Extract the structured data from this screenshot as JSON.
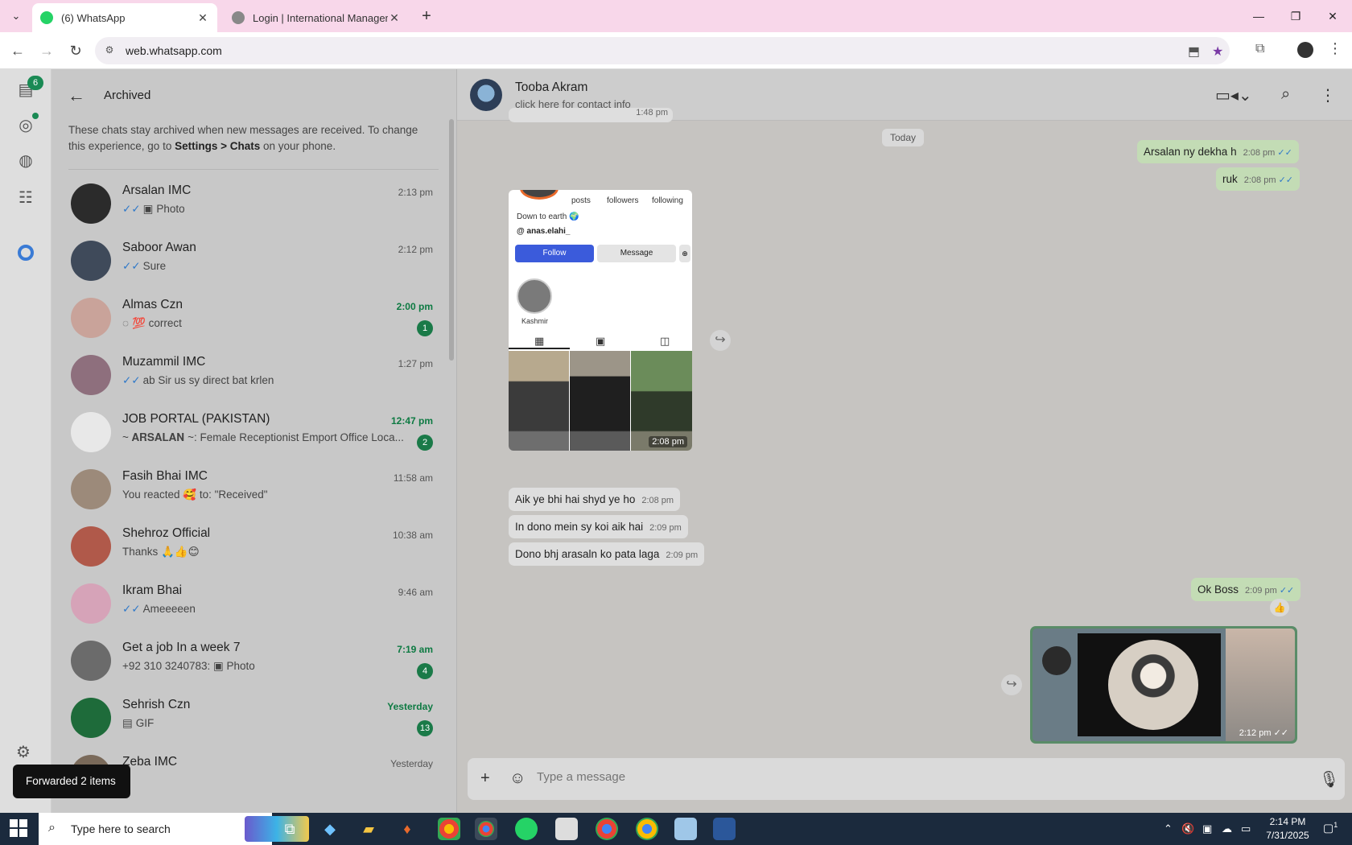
{
  "browser": {
    "tabs": [
      {
        "label": "(6) WhatsApp",
        "active": true
      },
      {
        "label": "Login | International Manageme",
        "active": false
      }
    ],
    "url": "web.whatsapp.com"
  },
  "rail": {
    "chats_badge": "6"
  },
  "panel": {
    "title": "Archived",
    "note_part1": "These chats stay archived when new messages are received. To change this experience, go to ",
    "note_bold1": "Settings > Chats",
    "note_part2": " on your phone.",
    "chats": [
      {
        "name": "Arsalan IMC",
        "time": "2:13 pm",
        "preview": "Photo",
        "ticks": "✓✓",
        "media": "▣",
        "unread": "",
        "avatar_color": "#2b2b2b"
      },
      {
        "name": "Saboor Awan",
        "time": "2:12 pm",
        "preview": "Sure",
        "ticks": "✓✓",
        "media": "",
        "unread": "",
        "avatar_color": "#3f4a5a"
      },
      {
        "name": "Almas Czn",
        "time": "2:00 pm",
        "preview": "💯 correct",
        "ticks": "",
        "media": "◌",
        "unread": "1",
        "avatar_color": "#c9a39a"
      },
      {
        "name": "Muzammil IMC",
        "time": "1:27 pm",
        "preview": "ab Sir us sy direct bat krlen",
        "ticks": "✓✓",
        "media": "",
        "unread": "",
        "avatar_color": "#8e6f7d"
      },
      {
        "name": "JOB PORTAL (PAKISTAN)",
        "time": "12:47 pm",
        "preview": "~ 𝐀𝐑𝐒𝐀𝐋𝐀𝐍 ~: Female Receptionist Emport Office  Loca...",
        "ticks": "",
        "media": "",
        "unread": "2",
        "avatar_color": "#e8e8e8"
      },
      {
        "name": "Fasih Bhai IMC",
        "time": "11:58 am",
        "preview": "You reacted 🥰 to: \"Received\"",
        "ticks": "",
        "media": "",
        "unread": "",
        "avatar_color": "#9c8a7a"
      },
      {
        "name": "Shehroz Official",
        "time": "10:38 am",
        "preview": "Thanks 🙏👍😊",
        "ticks": "",
        "media": "",
        "unread": "",
        "avatar_color": "#b0594a"
      },
      {
        "name": "Ikram Bhai",
        "time": "9:46 am",
        "preview": "Ameeeeen",
        "ticks": "✓✓",
        "media": "",
        "unread": "",
        "avatar_color": "#d6a3b8"
      },
      {
        "name": "Get a job In a week 7",
        "time": "7:19 am",
        "preview": "+92 310 3240783: ▣ Photo",
        "ticks": "",
        "media": "",
        "unread": "4",
        "avatar_color": "#6b6b6b"
      },
      {
        "name": "Sehrish Czn",
        "time": "Yesterday",
        "preview": "GIF",
        "ticks": "",
        "media": "▤",
        "unread": "13",
        "avatar_color": "#1e6b3a"
      },
      {
        "name": "Zeba IMC",
        "time": "Yesterday",
        "preview": "",
        "ticks": "",
        "media": "",
        "unread": "",
        "avatar_color": "#7a6a5a"
      }
    ]
  },
  "toast": "Forwarded 2 items",
  "conversation": {
    "name": "Tooba Akram",
    "subtitle": "click here for contact info",
    "partial_time": "1:48 pm",
    "date_divider": "Today",
    "messages": {
      "out1": {
        "text": "Arsalan ny dekha h",
        "time": "2:08 pm"
      },
      "out2": {
        "text": "ruk",
        "time": "2:08 pm"
      },
      "in1": {
        "text": "Aik ye bhi hai shyd ye ho",
        "time": "2:08 pm"
      },
      "in2": {
        "text": "In dono mein sy koi aik hai",
        "time": "2:09 pm"
      },
      "in3": {
        "text": "Dono bhj arasaln ko pata laga",
        "time": "2:09 pm"
      },
      "out3": {
        "text": "Ok Boss",
        "time": "2:09 pm"
      }
    },
    "insta_card": {
      "posts": "posts",
      "followers": "followers",
      "following": "following",
      "bio": "Down to earth 🌍",
      "handle": "@ anas.elahi_",
      "follow": "Follow",
      "message": "Message",
      "highlight": "Kashmir",
      "time": "2:08 pm"
    },
    "video_time": "2:12 pm",
    "reaction": "👍",
    "composer_placeholder": "Type a message"
  },
  "taskbar": {
    "search_placeholder": "Type here to search",
    "time": "2:14 PM",
    "date": "7/31/2025",
    "notifications": "1"
  }
}
